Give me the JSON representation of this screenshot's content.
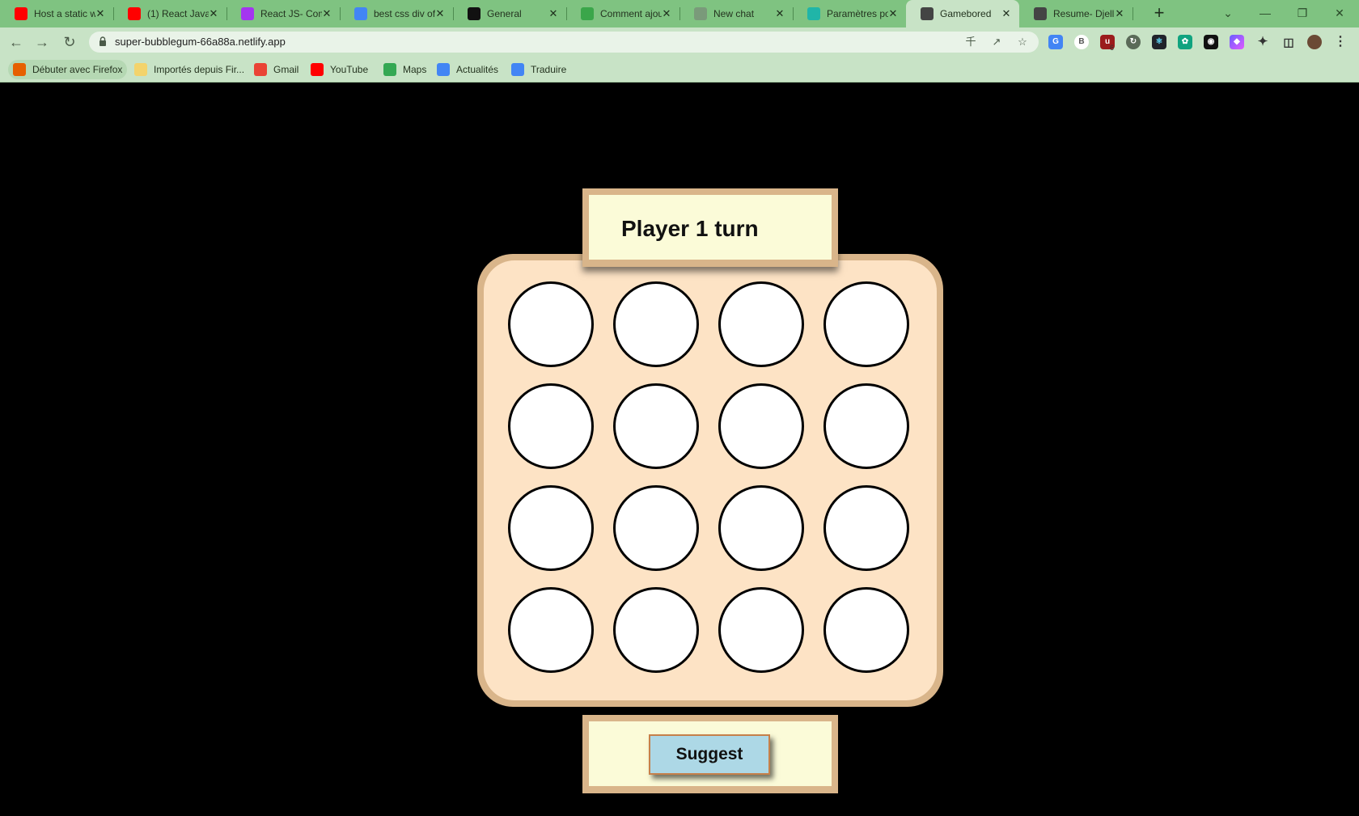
{
  "browser": {
    "tabs": [
      {
        "title": "Host a static w",
        "icon": "youtube-icon",
        "color": "#ff0000"
      },
      {
        "title": "(1) React JavaS",
        "icon": "youtube-icon",
        "color": "#ff0000"
      },
      {
        "title": "React JS- Com",
        "icon": "udemy-icon",
        "color": "#a435f0"
      },
      {
        "title": "best css div of",
        "icon": "google-icon",
        "color": "#4285f4"
      },
      {
        "title": "General",
        "icon": "github-icon",
        "color": "#111111"
      },
      {
        "title": "Comment ajou",
        "icon": "wikihow-icon",
        "color": "#3aa64a"
      },
      {
        "title": "New chat",
        "icon": "chatgpt-icon",
        "color": "#7a9a7a"
      },
      {
        "title": "Paramètres po",
        "icon": "netlify-icon",
        "color": "#20b5a8"
      },
      {
        "title": "Gamebored",
        "icon": "globe-icon",
        "color": "#444444",
        "active": true
      },
      {
        "title": "Resume- Djell",
        "icon": "globe-icon",
        "color": "#444444"
      }
    ],
    "url": "super-bubblegum-66a88a.netlify.app",
    "bookmarks": [
      {
        "label": "Débuter avec Firefox",
        "icon": "firefox-icon",
        "color": "#e66000"
      },
      {
        "label": "Importés depuis Fir...",
        "icon": "folder-icon",
        "color": "#f3d36b"
      },
      {
        "label": "Gmail",
        "icon": "gmail-icon",
        "color": "#ea4335"
      },
      {
        "label": "YouTube",
        "icon": "youtube-icon",
        "color": "#ff0000"
      },
      {
        "label": "Maps",
        "icon": "maps-icon",
        "color": "#34a853"
      },
      {
        "label": "Actualités",
        "icon": "news-icon",
        "color": "#4285f4"
      },
      {
        "label": "Traduire",
        "icon": "translate-icon",
        "color": "#4285f4"
      }
    ],
    "extension_badge": "6"
  },
  "game": {
    "turn_text": "Player 1 turn",
    "suggest_label": "Suggest",
    "rows": 4,
    "cols": 4,
    "cells": [
      "",
      "",
      "",
      "",
      "",
      "",
      "",
      "",
      "",
      "",
      "",
      "",
      "",
      "",
      "",
      ""
    ],
    "colors": {
      "frame": "#d9b58a",
      "board": "#fde3c5",
      "panel": "#fbfbd8",
      "button": "#add8e6",
      "background": "#000000"
    }
  }
}
